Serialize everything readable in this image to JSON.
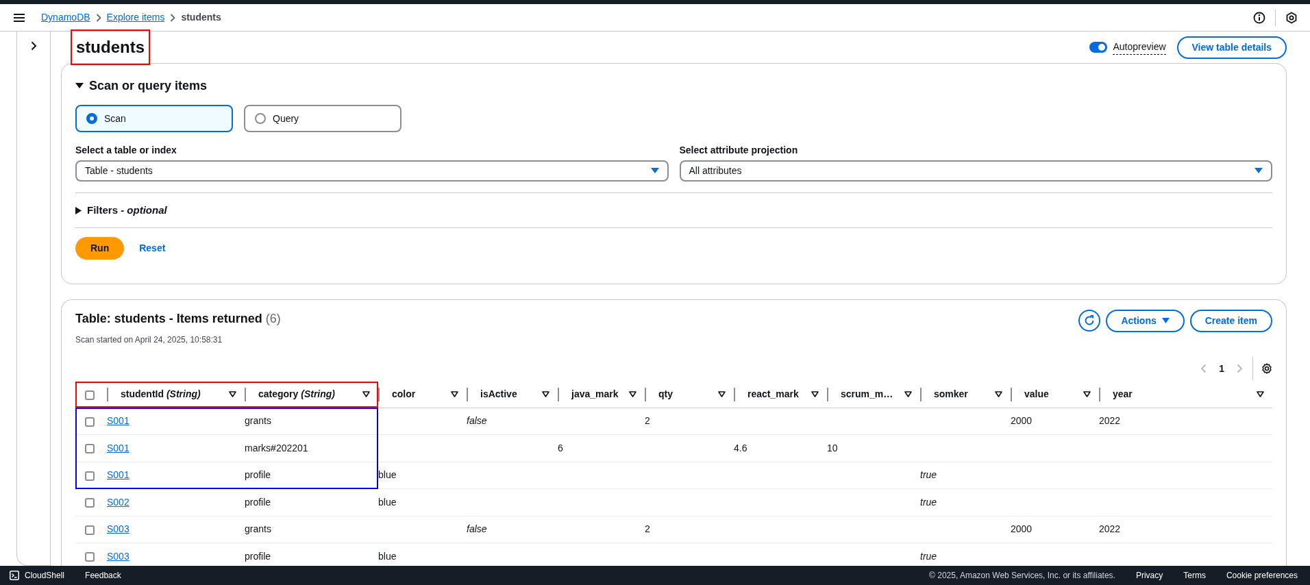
{
  "breadcrumb": [
    {
      "text": "DynamoDB",
      "kind": "link"
    },
    {
      "text": "Explore items",
      "kind": "link"
    },
    {
      "text": "students",
      "kind": "current"
    }
  ],
  "title": {
    "text": "students"
  },
  "highlights": [
    {
      "kind": "title",
      "color": "#ff0000"
    },
    {
      "kind": "header",
      "color": "#ff0000"
    },
    {
      "kind": "rows",
      "color": "#0000ff"
    }
  ],
  "autopreview": {
    "label": "Autopreview",
    "on": true
  },
  "view_details_button": "View table details",
  "scan_panel": {
    "title": "Scan or query items",
    "expanded": true,
    "modes": [
      {
        "label": "Scan",
        "selected": true
      },
      {
        "label": "Query",
        "selected": false
      }
    ],
    "table_select": {
      "label": "Select a table or index",
      "value": "Table - students"
    },
    "projection_select": {
      "label": "Select attribute projection",
      "value": "All attributes"
    },
    "filters": {
      "label": "Filters *- optional*",
      "expanded": false
    },
    "run_button": "Run",
    "reset_button": "Reset"
  },
  "results": {
    "title": "Table: students - Items returned",
    "count": "(6)",
    "subtitle": "Scan started on April 24, 2025, 10:58:31",
    "actions_button": "Actions",
    "create_button": "Create item",
    "pagination": {
      "page": "1",
      "prev_disabled": true,
      "next_disabled": true
    },
    "header_checked": false,
    "columns": [
      {
        "label": "studentId *(String)*",
        "highlighted": true
      },
      {
        "label": "category *(String)*",
        "highlighted": true
      },
      {
        "label": "color",
        "highlighted": false
      },
      {
        "label": "isActive",
        "highlighted": false
      },
      {
        "label": "java_mark",
        "highlighted": false
      },
      {
        "label": "qty",
        "highlighted": false
      },
      {
        "label": "react_mark",
        "highlighted": false
      },
      {
        "label": "scrum_m…",
        "highlighted": false
      },
      {
        "label": "somker",
        "highlighted": false
      },
      {
        "label": "value",
        "highlighted": false
      },
      {
        "label": "year",
        "highlighted": false
      }
    ],
    "rows": [
      {
        "selected": false,
        "highlighted": true,
        "cells": [
          {
            "text": "S001",
            "kind": "link"
          },
          {
            "text": "grants",
            "kind": "string"
          },
          null,
          {
            "text": "false",
            "kind": "boolean"
          },
          null,
          {
            "text": "2",
            "kind": "number"
          },
          null,
          null,
          null,
          {
            "text": "2000",
            "kind": "number"
          },
          {
            "text": "2022",
            "kind": "number"
          }
        ]
      },
      {
        "selected": false,
        "highlighted": true,
        "cells": [
          {
            "text": "S001",
            "kind": "link"
          },
          {
            "text": "marks#202201",
            "kind": "string"
          },
          null,
          null,
          {
            "text": "6",
            "kind": "number"
          },
          null,
          {
            "text": "4.6",
            "kind": "number"
          },
          {
            "text": "10",
            "kind": "number"
          },
          null,
          null,
          null
        ]
      },
      {
        "selected": false,
        "highlighted": true,
        "cells": [
          {
            "text": "S001",
            "kind": "link"
          },
          {
            "text": "profile",
            "kind": "string"
          },
          {
            "text": "blue",
            "kind": "string"
          },
          null,
          null,
          null,
          null,
          null,
          {
            "text": "true",
            "kind": "boolean"
          },
          null,
          null
        ]
      },
      {
        "selected": false,
        "highlighted": false,
        "cells": [
          {
            "text": "S002",
            "kind": "link"
          },
          {
            "text": "profile",
            "kind": "string"
          },
          {
            "text": "blue",
            "kind": "string"
          },
          null,
          null,
          null,
          null,
          null,
          {
            "text": "true",
            "kind": "boolean"
          },
          null,
          null
        ]
      },
      {
        "selected": false,
        "highlighted": false,
        "cells": [
          {
            "text": "S003",
            "kind": "link"
          },
          {
            "text": "grants",
            "kind": "string"
          },
          null,
          {
            "text": "false",
            "kind": "boolean"
          },
          null,
          {
            "text": "2",
            "kind": "number"
          },
          null,
          null,
          null,
          {
            "text": "2000",
            "kind": "number"
          },
          {
            "text": "2022",
            "kind": "number"
          }
        ]
      },
      {
        "selected": false,
        "highlighted": false,
        "cells": [
          {
            "text": "S003",
            "kind": "link"
          },
          {
            "text": "profile",
            "kind": "string"
          },
          {
            "text": "blue",
            "kind": "string"
          },
          null,
          null,
          null,
          null,
          null,
          {
            "text": "true",
            "kind": "boolean"
          },
          null,
          null
        ]
      }
    ]
  },
  "footer": {
    "cloudshell": "CloudShell",
    "feedback": "Feedback",
    "copyright": "© 2025, Amazon Web Services, Inc. or its affiliates.",
    "links": [
      "Privacy",
      "Terms",
      "Cookie preferences"
    ]
  }
}
